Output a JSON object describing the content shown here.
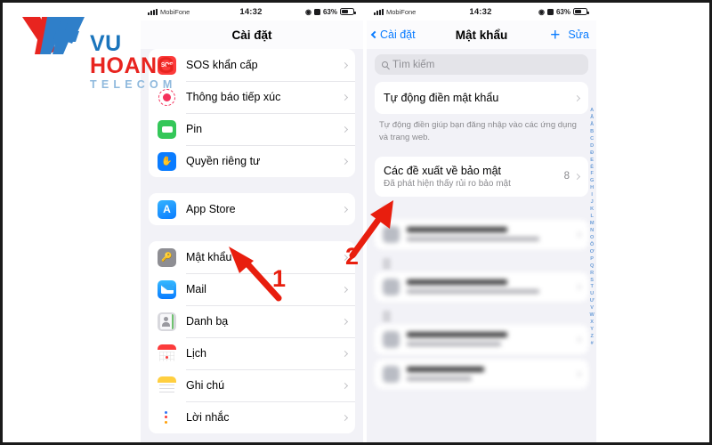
{
  "watermark": {
    "brand_line1_a": "VU ",
    "brand_line1_b": "HOANG",
    "brand_line2": "TELECOM",
    "color_red": "#e8241f",
    "color_blue": "#1b75bc",
    "color_tel": "#8fb9dd"
  },
  "phone_left": {
    "status": {
      "carrier": "MobiFone",
      "time": "14:32",
      "battery_percent": "63%"
    },
    "nav": {
      "title": "Cài đặt"
    },
    "groups": [
      {
        "rows": [
          {
            "icon": "sos-icon",
            "label": "SOS khẩn cấp"
          },
          {
            "icon": "exposure-notification-icon",
            "label": "Thông báo tiếp xúc"
          },
          {
            "icon": "battery-icon",
            "label": "Pin"
          },
          {
            "icon": "privacy-hand-icon",
            "label": "Quyền riêng tư"
          }
        ]
      },
      {
        "rows": [
          {
            "icon": "app-store-icon",
            "label": "App Store"
          }
        ]
      },
      {
        "rows": [
          {
            "icon": "passwords-key-icon",
            "label": "Mật khẩu"
          },
          {
            "icon": "mail-icon",
            "label": "Mail"
          },
          {
            "icon": "contacts-icon",
            "label": "Danh bạ"
          },
          {
            "icon": "calendar-icon",
            "label": "Lịch"
          },
          {
            "icon": "notes-icon",
            "label": "Ghi chú"
          },
          {
            "icon": "reminders-icon",
            "label": "Lời nhắc"
          }
        ]
      }
    ]
  },
  "phone_right": {
    "status": {
      "carrier": "MobiFone",
      "time": "14:32",
      "battery_percent": "63%"
    },
    "nav": {
      "back_label": "Cài đặt",
      "title": "Mật khẩu",
      "add_label": "+",
      "edit_label": "Sửa"
    },
    "search": {
      "placeholder": "Tìm kiếm"
    },
    "autofill": {
      "title": "Tự động điền mật khẩu",
      "footnote": "Tự động điền giúp bạn đăng nhập vào các ứng dụng và trang web."
    },
    "security": {
      "title": "Các đề xuất về bảo mật",
      "subtitle": "Đã phát hiện thấy rủi ro bảo mật",
      "count": "8"
    },
    "alphabet_index": [
      "A",
      "Ă",
      "Â",
      "B",
      "C",
      "D",
      "Đ",
      "E",
      "Ê",
      "F",
      "G",
      "H",
      "I",
      "J",
      "K",
      "L",
      "M",
      "N",
      "O",
      "Ô",
      "Ơ",
      "P",
      "Q",
      "R",
      "S",
      "T",
      "U",
      "Ư",
      "V",
      "W",
      "X",
      "Y",
      "Z",
      "#"
    ]
  },
  "annotations": {
    "step1": "1",
    "step2": "2",
    "color": "#e81e0e"
  }
}
